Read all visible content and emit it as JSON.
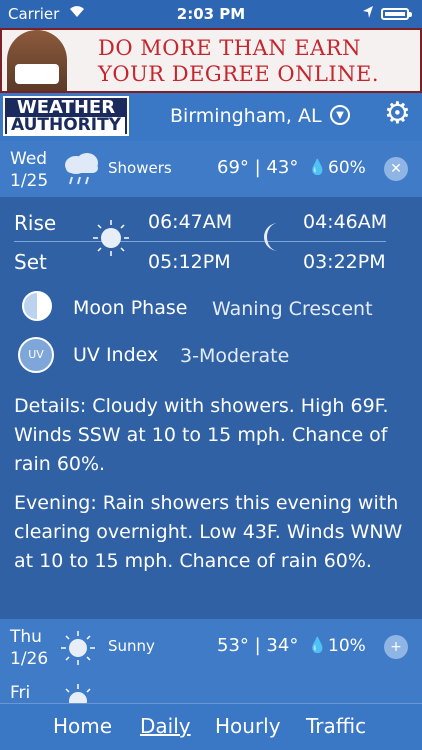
{
  "status_bar": {
    "carrier": "Carrier",
    "time": "2:03 PM"
  },
  "ad": {
    "line1": "DO MORE THAN EARN",
    "line2": "YOUR DEGREE ONLINE."
  },
  "header": {
    "logo_line1": "WEATHER",
    "logo_line2": "AUTHORITY",
    "city": "Birmingham, AL"
  },
  "days": [
    {
      "day": "Wed",
      "date": "1/25",
      "condition": "Showers",
      "high": "69°",
      "low": "43°",
      "precip": "60%",
      "icon": "cloud-rain-icon"
    },
    {
      "day": "Thu",
      "date": "1/26",
      "condition": "Sunny",
      "high": "53°",
      "low": "34°",
      "precip": "10%",
      "icon": "sun-icon"
    },
    {
      "day": "Fri"
    }
  ],
  "details": {
    "rise_label": "Rise",
    "set_label": "Set",
    "sunrise": "06:47AM",
    "sunset": "05:12PM",
    "moonrise": "04:46AM",
    "moonset": "03:22PM",
    "moon_phase_label": "Moon Phase",
    "moon_phase_value": "Waning Crescent",
    "uv_label": "UV Index",
    "uv_icon_text": "UV",
    "uv_value": "3-Moderate",
    "details_text": "Details: Cloudy with showers. High 69F. Winds SSW at 10 to 15 mph. Chance of rain 60%.",
    "evening_text": "Evening: Rain showers this evening with clearing overnight. Low 43F. Winds WNW at 10 to 15 mph. Chance of rain 60%."
  },
  "tabs": [
    {
      "label": "Home"
    },
    {
      "label": "Daily",
      "active": true
    },
    {
      "label": "Hourly"
    },
    {
      "label": "Traffic"
    }
  ],
  "colors": {
    "background": "#2f61a4",
    "row": "#3f7bc7",
    "header": "#3a78c6",
    "ad_text": "#c4262d"
  }
}
